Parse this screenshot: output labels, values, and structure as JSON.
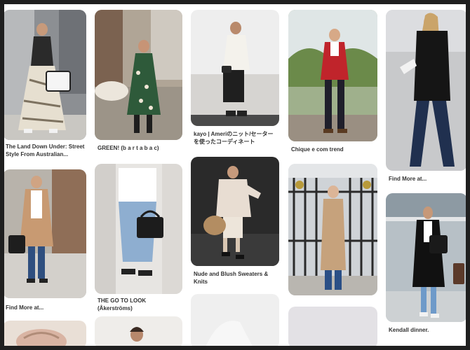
{
  "pins": [
    {
      "id": "land-down-under",
      "caption": "The Land Down Under: Street Style From Australian..."
    },
    {
      "id": "green-bartabac",
      "caption": "GREEN! (b a r t a b a c)"
    },
    {
      "id": "kayo-knit",
      "caption": "kayo | Ameriのニット/セーターを使ったコーディネート"
    },
    {
      "id": "chique-trend",
      "caption": "Chique e com trend"
    },
    {
      "id": "find-more-right",
      "caption": "Find More at..."
    },
    {
      "id": "find-more-left",
      "caption": "Find More at..."
    },
    {
      "id": "go-to-look",
      "caption": "THE GO TO LOOK (Åkerströms)"
    },
    {
      "id": "nude-blush",
      "caption": "Nude and Blush Sweaters & Knits"
    },
    {
      "id": "kendall",
      "caption": "Kendall dinner."
    }
  ],
  "colors": {
    "background": "#ffffff",
    "frame": "#1f1f1f",
    "caption_text": "#333333"
  }
}
